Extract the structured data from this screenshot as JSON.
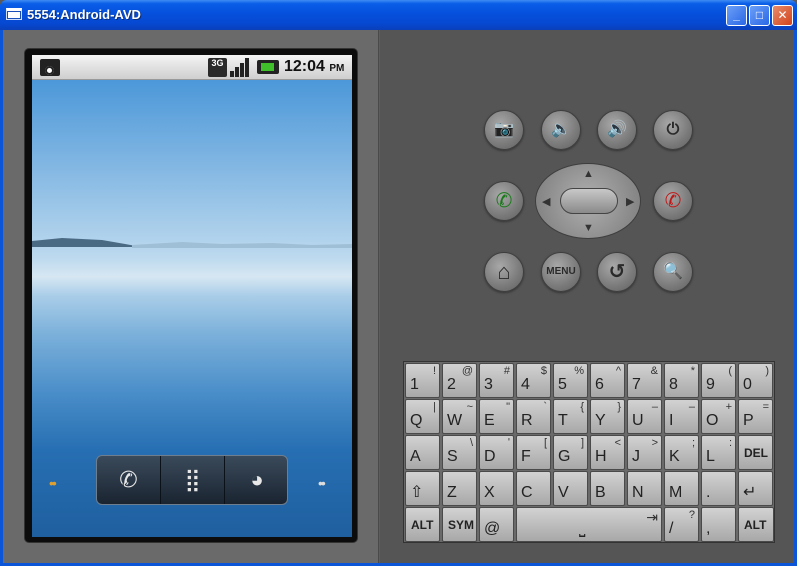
{
  "window": {
    "title": "5554:Android-AVD",
    "minimize": "_",
    "maximize": "□",
    "close": "✕"
  },
  "statusbar": {
    "network": "3G",
    "time": "12:04",
    "ampm": "PM"
  },
  "dock": {
    "phone": "✆",
    "apps": "⣿",
    "browser": "◕"
  },
  "dots_left": "••",
  "dots_right": "••",
  "controls": {
    "menu_label": "MENU",
    "camera": "📷",
    "vol_down": "🔈",
    "vol_up": "🔊",
    "power": "⏻",
    "home": "⌂",
    "back": "↺",
    "search": "🔍",
    "call": "✆",
    "hangup": "✆"
  },
  "keyboard": {
    "row1": [
      [
        "1",
        "!"
      ],
      [
        "2",
        "@"
      ],
      [
        "3",
        "#"
      ],
      [
        "4",
        "$"
      ],
      [
        "5",
        "%"
      ],
      [
        "6",
        "^"
      ],
      [
        "7",
        "&"
      ],
      [
        "8",
        "*"
      ],
      [
        "9",
        "("
      ],
      [
        "0",
        ")"
      ]
    ],
    "row2": [
      [
        "Q",
        "|"
      ],
      [
        "W",
        "~"
      ],
      [
        "E",
        "\""
      ],
      [
        "R",
        "`"
      ],
      [
        "T",
        "{"
      ],
      [
        "Y",
        "}"
      ],
      [
        "U",
        "–"
      ],
      [
        "I",
        "–"
      ],
      [
        "O",
        "+"
      ],
      [
        "P",
        "="
      ]
    ],
    "row3": [
      [
        "A",
        ""
      ],
      [
        "S",
        "\\"
      ],
      [
        "D",
        "ʹ"
      ],
      [
        "F",
        "["
      ],
      [
        "G",
        "]"
      ],
      [
        "H",
        "<"
      ],
      [
        "J",
        ">"
      ],
      [
        "K",
        ";"
      ],
      [
        "L",
        ":"
      ],
      [
        "DEL",
        ""
      ]
    ],
    "row4": [
      [
        "⇧",
        ""
      ],
      [
        "Z",
        ""
      ],
      [
        "X",
        ""
      ],
      [
        "C",
        ""
      ],
      [
        "V",
        ""
      ],
      [
        "B",
        ""
      ],
      [
        "N",
        ""
      ],
      [
        "M",
        ""
      ],
      [
        ".",
        ""
      ],
      [
        "↵",
        ""
      ]
    ],
    "row5": {
      "alt_left": "ALT",
      "sym": "SYM",
      "at": "@",
      "space": "⎵",
      "tab": "⇥",
      "slash": "/",
      "question": "?",
      "comma": ",",
      "alt_right": "ALT"
    }
  }
}
